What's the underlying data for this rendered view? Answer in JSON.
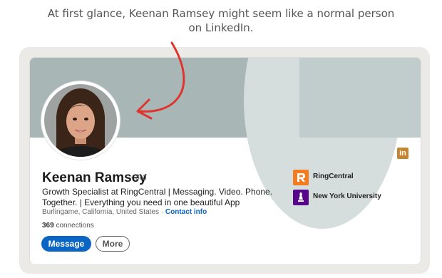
{
  "caption": {
    "line1": "At first glance, Keenan Ramsey might seem like a normal person",
    "line2": "on LinkedIn."
  },
  "profile": {
    "name": "Keenan Ramsey",
    "degree": "· 3rd",
    "headline_line1": "Growth Specialist at RingCentral | Messaging. Video. Phone.",
    "headline_line2": "Together. | Everything you need in one beautiful App",
    "location": "Burlingame, California, United States ·",
    "contact_label": "Contact info",
    "connections_count": "369",
    "connections_label": "connections"
  },
  "actions": {
    "message_label": "Message",
    "more_label": "More"
  },
  "organizations": [
    {
      "name": "RingCentral",
      "logo": "ringcentral-logo"
    },
    {
      "name": "New York University",
      "logo": "nyu-logo"
    }
  ],
  "icons": {
    "linkedin": "linkedin-icon",
    "linkedin_text": "in"
  },
  "colors": {
    "annotation_arrow": "#e0342f",
    "primary_button": "#0a66c2",
    "ringcentral": "#f47b20",
    "nyu": "#57068c",
    "linkedin_icon": "#c5842e"
  }
}
